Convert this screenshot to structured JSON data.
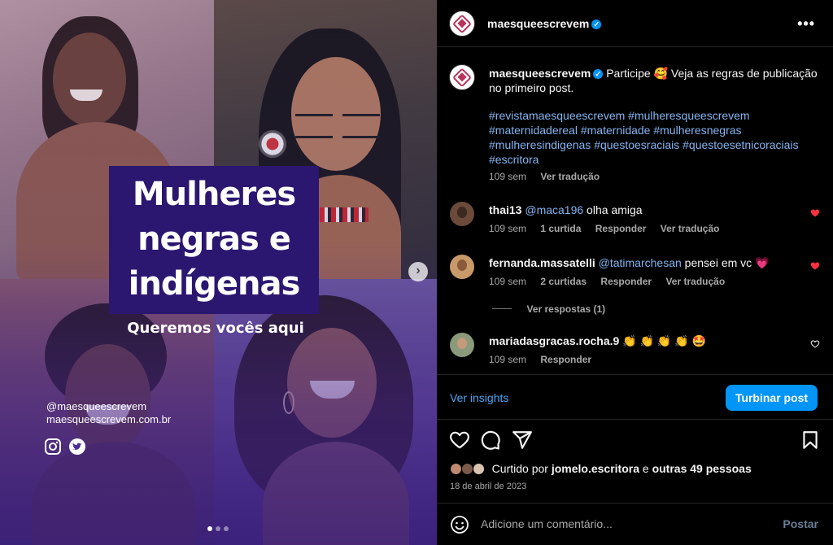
{
  "image": {
    "title_lines": [
      "Mulheres",
      "negras e",
      "indígenas"
    ],
    "subtitle": "Queremos vocês aqui",
    "handle": "@maesqueescrevem",
    "website": "maesqueescrevem.com.br",
    "social_icons": [
      "instagram-icon",
      "twitter-icon"
    ],
    "carousel_dots": 3,
    "active_dot": 0
  },
  "header": {
    "username": "maesqueescrevem",
    "verified_glyph": "✓",
    "more_glyph": "•••"
  },
  "caption": {
    "username": "maesqueescrevem",
    "text_before_emoji": "Participe ",
    "emoji": "🥰",
    "text_after_emoji": " Veja as regras de publicação no primeiro post.",
    "hashtags": "#revistamaesqueescrevem #mulheresqueescrevem #maternidadereal #maternidade #mulheresnegras #mulheresindigenas #questoesraciais #questoesetnicoraciais #escritora",
    "time": "109 sem",
    "translate": "Ver tradução"
  },
  "comments": [
    {
      "username": "thai13",
      "mention": "@maca196",
      "text": " olha amiga",
      "time": "109 sem",
      "likes": "1 curtida",
      "reply": "Responder",
      "translate": "Ver tradução",
      "liked": true,
      "avatar_color": "#6b4a3a"
    },
    {
      "username": "fernanda.massatelli",
      "mention": "@tatimarchesan",
      "text": " pensei em vc 💗",
      "time": "109 sem",
      "likes": "2 curtidas",
      "reply": "Responder",
      "translate": "Ver tradução",
      "liked": true,
      "avatar_color": "#c89a6a"
    },
    {
      "username": "mariadasgracas.rocha.9",
      "mention": "",
      "text": " 👏 👏 👏 👏 🤩",
      "time": "109 sem",
      "likes": "",
      "reply": "Responder",
      "translate": "",
      "liked": false,
      "avatar_color": "#8a9a7a"
    }
  ],
  "replies_toggle": "Ver respostas (1)",
  "insights": {
    "link": "Ver insights",
    "button": "Turbinar post"
  },
  "likes": {
    "prefix": "Curtido por ",
    "user": "jomelo.escritora",
    "middle": " e ",
    "others": "outras 49 pessoas"
  },
  "date": "18 de abril de 2023",
  "comment_box": {
    "placeholder": "Adicione um comentário...",
    "post": "Postar"
  },
  "colors": {
    "accent_blue": "#0095f6",
    "link_blue": "#83b4f0",
    "like_red": "#ff3040",
    "brand_pink": "#b8335a",
    "title_box": "#2b1670"
  }
}
